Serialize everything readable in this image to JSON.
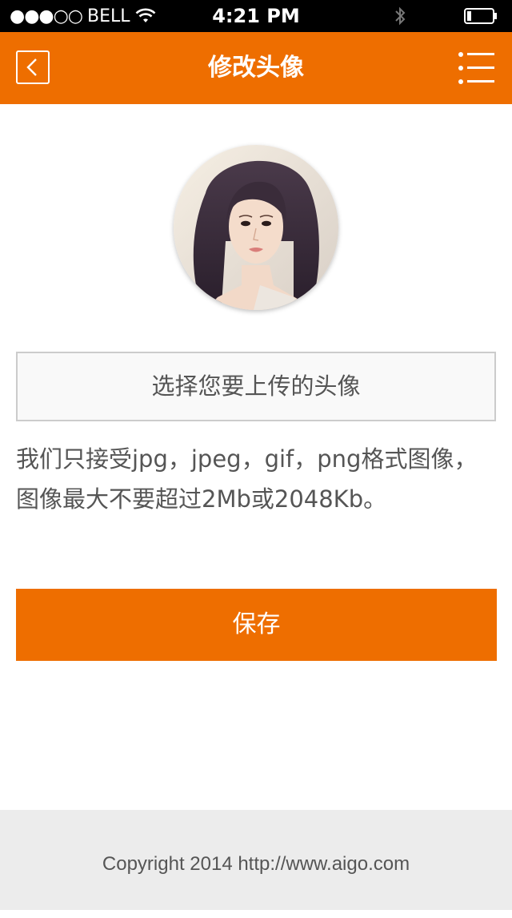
{
  "status_bar": {
    "signal": "●●●○○",
    "carrier": "BELL",
    "time": "4:21 PM",
    "icons": [
      "wifi-icon",
      "bluetooth-icon",
      "battery-icon"
    ]
  },
  "header": {
    "title": "修改头像",
    "back_icon": "chevron-left-icon",
    "menu_icon": "menu-icon",
    "color": "#ee6e00"
  },
  "avatar": {
    "alt": "user-avatar"
  },
  "upload": {
    "label": "选择您要上传的头像"
  },
  "notice": {
    "line1": "我们只接受jpg，jpeg，gif，png格式图像，",
    "line2": "图像最大不要超过2Mb或2048Kb。"
  },
  "save": {
    "label": "保存"
  },
  "footer": {
    "text": "Copyright 2014 http://www.aigo.com"
  }
}
